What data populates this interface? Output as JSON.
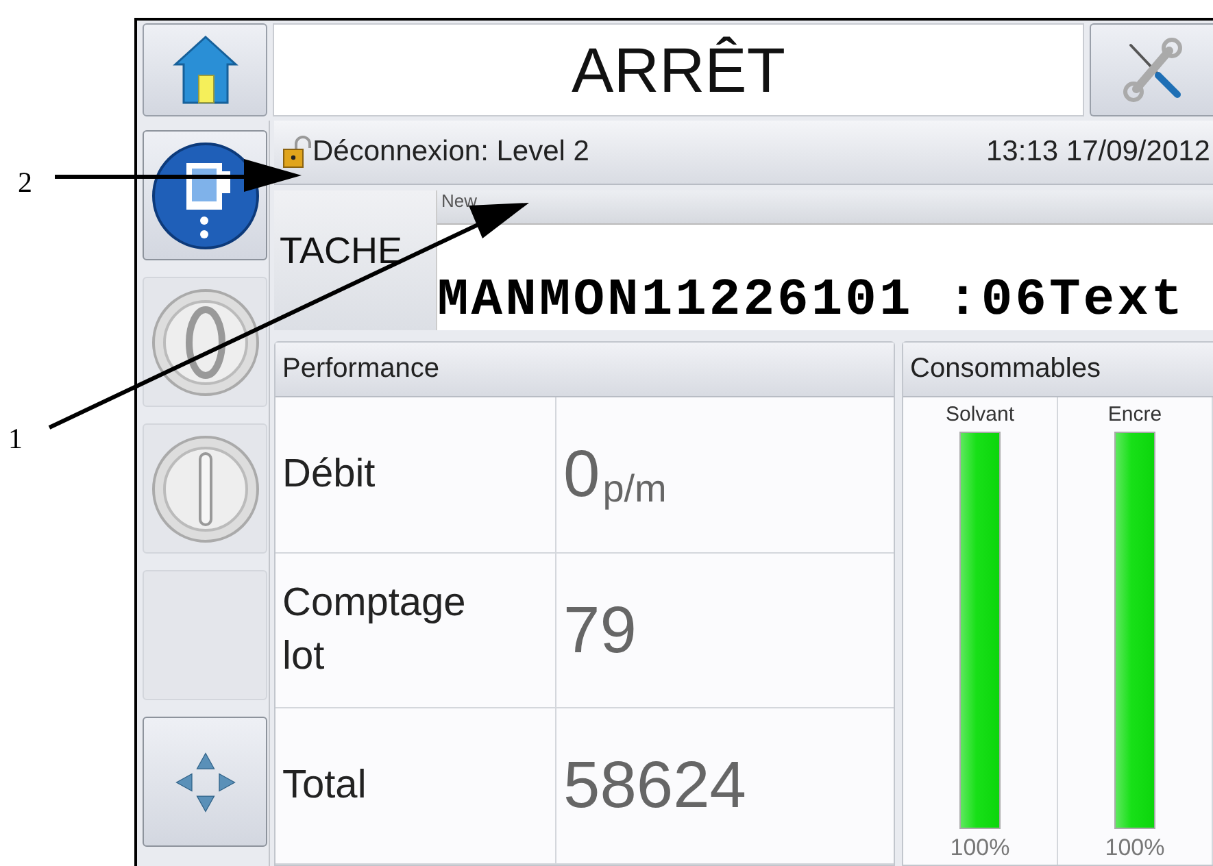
{
  "callouts": [
    {
      "number": "2"
    },
    {
      "number": "1"
    }
  ],
  "header": {
    "title": "ARRÊT"
  },
  "sidebar": [
    {
      "kind": "printhead"
    },
    {
      "kind": "stop"
    },
    {
      "kind": "start"
    },
    {
      "kind": "blank"
    },
    {
      "kind": "navigation"
    }
  ],
  "status_bar": {
    "login": "Déconnexion: Level 2",
    "datetime": "13:13 17/09/2012"
  },
  "job": {
    "label": "TACHE",
    "name": "New",
    "message": "MANMON11226101 :06Text"
  },
  "performance": {
    "title": "Performance",
    "rows": [
      {
        "label": "Débit",
        "value": "0",
        "unit": "p/m"
      },
      {
        "label": "Comptage lot",
        "value": "79"
      },
      {
        "label": "Total",
        "value": "58624"
      }
    ]
  },
  "consumables": {
    "title": "Consommables",
    "items": [
      {
        "name": "Solvant",
        "level": 1,
        "reading": "100%"
      },
      {
        "name": "Encre",
        "level": 1,
        "reading": "100%"
      }
    ]
  }
}
